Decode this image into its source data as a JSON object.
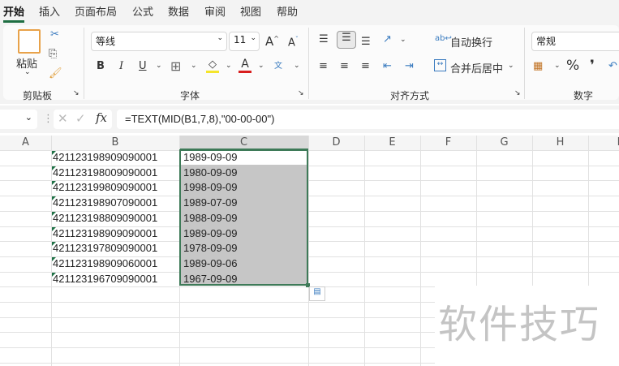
{
  "tabs": [
    "开始",
    "插入",
    "页面布局",
    "公式",
    "数据",
    "审阅",
    "视图",
    "帮助"
  ],
  "clipboard": {
    "paste": "粘贴",
    "group": "剪贴板"
  },
  "font": {
    "name": "等线",
    "size": "11",
    "group": "字体",
    "bold": "B",
    "italic": "I",
    "underline": "U",
    "phonetic": "文"
  },
  "alignment": {
    "wrap": "自动换行",
    "merge": "合并后居中",
    "group": "对齐方式"
  },
  "number": {
    "format": "常规",
    "percent": "%",
    "comma": "❜",
    "group": "数字"
  },
  "formula_bar": {
    "fx": "fx",
    "formula": "=TEXT(MID(B1,7,8),\"00-00-00\")"
  },
  "columns": [
    "A",
    "B",
    "C",
    "D",
    "E",
    "F",
    "G",
    "H",
    "I"
  ],
  "rows": [
    {
      "b": "421123198909090001",
      "c": "1989-09-09"
    },
    {
      "b": "421123198009090001",
      "c": "1980-09-09"
    },
    {
      "b": "421123199809090001",
      "c": "1998-09-09"
    },
    {
      "b": "421123198907090001",
      "c": "1989-07-09"
    },
    {
      "b": "421123198809090001",
      "c": "1988-09-09"
    },
    {
      "b": "421123198909090001",
      "c": "1989-09-09"
    },
    {
      "b": "421123197809090001",
      "c": "1978-09-09"
    },
    {
      "b": "421123198909060001",
      "c": "1989-09-06"
    },
    {
      "b": "421123196709090001",
      "c": "1967-09-09"
    }
  ],
  "watermark": "软件技巧",
  "colors": {
    "accent": "#1e6e42",
    "selection": "#c6c6c6"
  }
}
